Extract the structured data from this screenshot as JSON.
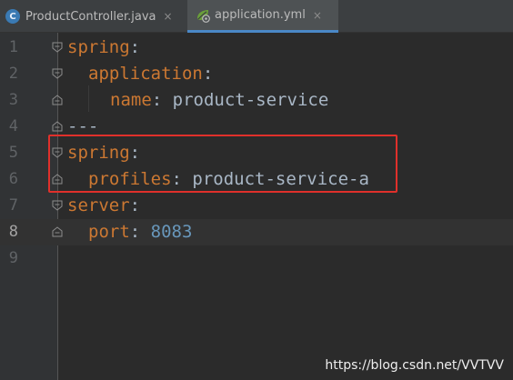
{
  "tabs": [
    {
      "label": "ProductController.java",
      "icon": "java-class-icon",
      "close": "×"
    },
    {
      "label": "application.yml",
      "icon": "spring-yml-icon",
      "close": "×"
    }
  ],
  "lines": [
    {
      "num": "1",
      "key": "spring",
      "colon": ":",
      "value": ""
    },
    {
      "num": "2",
      "key": "application",
      "colon": ":",
      "value": ""
    },
    {
      "num": "3",
      "key": "name",
      "colon": ":",
      "value": "product-service"
    },
    {
      "num": "4",
      "separator": "---"
    },
    {
      "num": "5",
      "key": "spring",
      "colon": ":",
      "value": ""
    },
    {
      "num": "6",
      "key": "profiles",
      "colon": ":",
      "value": "product-service-a"
    },
    {
      "num": "7",
      "key": "server",
      "colon": ":",
      "value": ""
    },
    {
      "num": "8",
      "key": "port",
      "colon": ":",
      "value": "8083"
    },
    {
      "num": "9"
    }
  ],
  "watermark": "https://blog.csdn.net/VVTVV",
  "colors": {
    "background": "#2b2b2b",
    "key": "#cc7832",
    "value": "#a9b7c6",
    "number": "#6897bb",
    "highlight_border": "#e0302b",
    "active_tab_underline": "#4a88c7"
  }
}
